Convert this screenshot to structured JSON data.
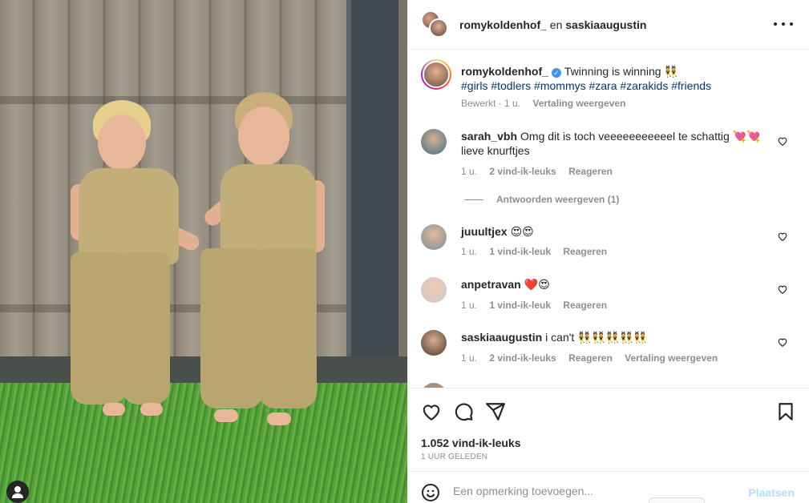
{
  "header": {
    "user1": "romykoldenhof_",
    "separator": "en",
    "user2": "saskiaaugustin"
  },
  "caption": {
    "username": "romykoldenhof_",
    "text": "Twinning is winning 👯",
    "hashtags": "#girls #todlers #mommys #zara #zarakids #friends",
    "edited": "Bewerkt · 1 u.",
    "translate": "Vertaling weergeven"
  },
  "comments": [
    {
      "username": "sarah_vbh",
      "text": "Omg dit is toch veeeeeeeeeeel te schattig 💘💘 lieve knurftjes",
      "time": "1 u.",
      "likes": "2 vind-ik-leuks",
      "reply": "Reageren",
      "replies_label": "Antwoorden weergeven (1)"
    },
    {
      "username": "juuultjex",
      "text": "😍😍",
      "time": "1 u.",
      "likes": "1 vind-ik-leuk",
      "reply": "Reageren"
    },
    {
      "username": "anpetravan",
      "text": "❤️😍",
      "time": "1 u.",
      "likes": "1 vind-ik-leuk",
      "reply": "Reageren"
    },
    {
      "username": "saskiaaugustin",
      "text": "i can't 👯👯👯👯👯",
      "time": "1 u.",
      "likes": "2 vind-ik-leuks",
      "reply": "Reageren",
      "translate": "Vertaling weergeven"
    }
  ],
  "actions": {
    "likes": "1.052 vind-ik-leuks",
    "time_ago": "1 UUR GELEDEN"
  },
  "add_comment": {
    "placeholder": "Een opmerking toevoegen...",
    "post_label": "Plaatsen"
  },
  "colors": {
    "link": "#00376b",
    "verified": "#3897f0",
    "post_disabled": "#b2dffc",
    "heart_red": "#ed4956"
  }
}
